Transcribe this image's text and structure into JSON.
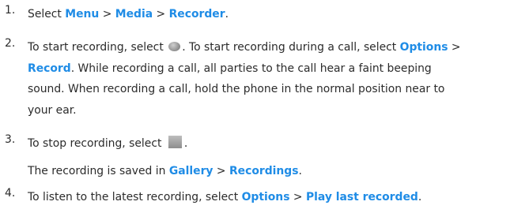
{
  "steps": [
    {
      "number": "1.",
      "t1": "Select ",
      "l1": "Menu",
      "s1": " > ",
      "l2": "Media",
      "s2": " > ",
      "l3": "Recorder",
      "end": "."
    },
    {
      "number": "2.",
      "a1": "To start recording, select ",
      "a2": ". To start recording during a call, select ",
      "a_link": "Options",
      "a3": " >",
      "b_link": "Record",
      "b1": ". While recording a call, all parties to the call hear a faint beeping",
      "c1": "sound. When recording a call, hold the phone in the normal position near to",
      "d1": "your ear.",
      "icon": "record-button-icon"
    },
    {
      "number": "3.",
      "a1": "To stop recording, select ",
      "a2": ".",
      "icon": "stop-button-icon",
      "b1": "The recording is saved in ",
      "b_link1": "Gallery",
      "b2": " > ",
      "b_link2": "Recordings",
      "b3": "."
    },
    {
      "number": "4.",
      "a1": "To listen to the latest recording, select ",
      "a_link1": "Options",
      "a2": " > ",
      "a_link2": "Play last recorded",
      "a3": "."
    }
  ],
  "colors": {
    "link": "#1f8ce6",
    "text": "#2b2b2b"
  }
}
